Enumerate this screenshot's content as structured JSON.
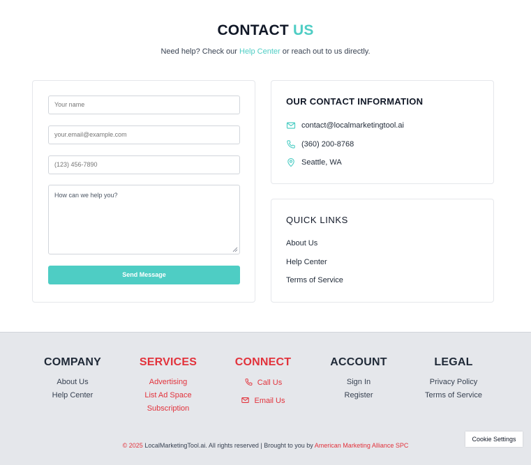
{
  "header": {
    "title_main": "CONTACT",
    "title_accent": "US",
    "subtitle_before": "Need help? Check our",
    "subtitle_link": "Help Center",
    "subtitle_after": "or reach out to us directly."
  },
  "form": {
    "name_placeholder": "Your name",
    "email_placeholder": "your.email@example.com",
    "phone_placeholder": "(123) 456-7890",
    "message_placeholder": "How can we help you?",
    "submit_label": "Send Message"
  },
  "contact_info": {
    "heading": "OUR CONTACT INFORMATION",
    "email": "contact@localmarketingtool.ai",
    "phone": "(360) 200-8768",
    "location": "Seattle, WA"
  },
  "quick_links": {
    "heading": "QUICK LINKS",
    "items": [
      "About Us",
      "Help Center",
      "Terms of Service"
    ]
  },
  "footer": {
    "company": {
      "heading": "COMPANY",
      "items": [
        "About Us",
        "Help Center"
      ]
    },
    "services": {
      "heading": "SERVICES",
      "items": [
        "Advertising",
        "List Ad Space",
        "Subscription"
      ]
    },
    "connect": {
      "heading": "CONNECT",
      "items": [
        "Call Us",
        "Email Us"
      ]
    },
    "account": {
      "heading": "ACCOUNT",
      "items": [
        "Sign In",
        "Register"
      ]
    },
    "legal": {
      "heading": "LEGAL",
      "items": [
        "Privacy Policy",
        "Terms of Service"
      ]
    },
    "copyright_prefix": "© 2025",
    "copyright_middle": "LocalMarketingTool.ai. All rights reserved | Brought to you by",
    "copyright_link": "American Marketing Alliance SPC",
    "cookie_settings": "Cookie Settings"
  },
  "colors": {
    "accent": "#4ecdc4",
    "footer_red": "#e2323b",
    "footer_bg": "#e5e7eb"
  },
  "icons": {
    "email": "mail-icon",
    "phone": "phone-icon",
    "location": "map-pin-icon"
  }
}
